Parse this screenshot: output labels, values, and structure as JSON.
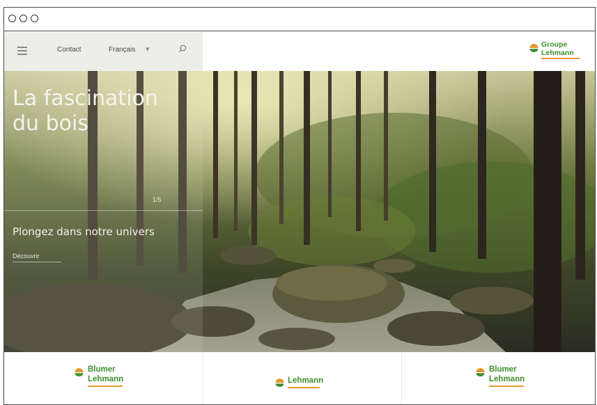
{
  "nav": {
    "contact": "Contact",
    "language": "Français"
  },
  "brand": {
    "line1": "Groupe",
    "line2": "Lehmann"
  },
  "hero": {
    "title_line1": "La fascination",
    "title_line2": "du bois",
    "pager": "1/5",
    "subtitle": "Plongez dans notre univers",
    "cta": "Découvrir"
  },
  "companies": [
    {
      "line1": "Blumer",
      "line2": "Lehmann"
    },
    {
      "line1": "Lehmann",
      "line2": ""
    },
    {
      "line1": "Blumer",
      "line2": "Lehmann"
    }
  ],
  "colors": {
    "brand_green": "#3e8e2f",
    "brand_orange": "#e39a2c",
    "nav_panel": "#eeeee9"
  },
  "icons": [
    "menu-icon",
    "chevron-down-icon",
    "search-icon",
    "sun-logo-icon"
  ]
}
